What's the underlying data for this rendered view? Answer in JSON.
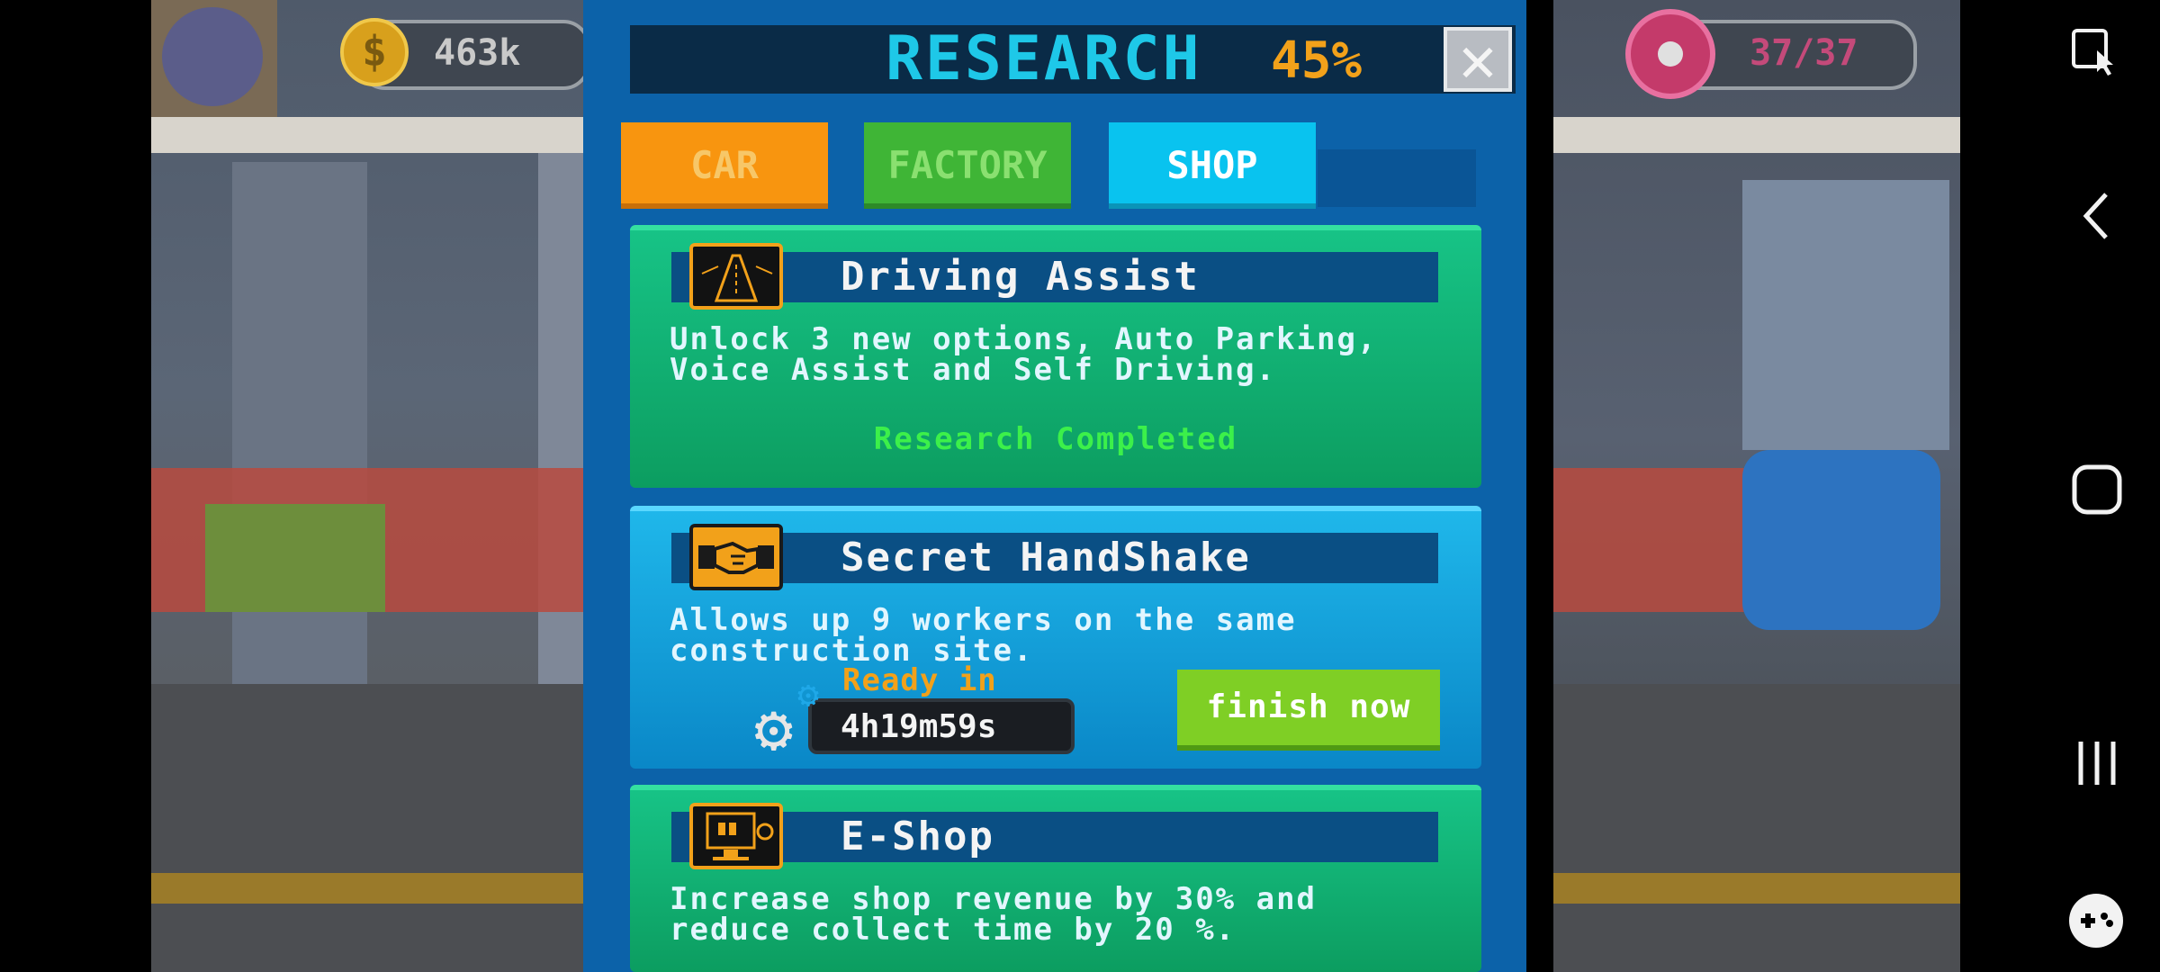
{
  "hud": {
    "money": "463k",
    "donuts": "37/37"
  },
  "research": {
    "title": "RESEARCH",
    "percent": "45%",
    "close_label": "✕"
  },
  "tabs": [
    {
      "label": "CAR"
    },
    {
      "label": "FACTORY"
    },
    {
      "label": "SHOP"
    }
  ],
  "cards": [
    {
      "title": "Driving Assist",
      "description": "Unlock 3 new options, Auto Parking,\nVoice Assist and Self Driving.",
      "status": "Research Completed"
    },
    {
      "title": "Secret HandShake",
      "description": "Allows up 9 workers on the same\nconstruction site.",
      "ready_label": "Ready in",
      "timer": "4h19m59s",
      "finish_label": "finish now"
    },
    {
      "title": "E-Shop",
      "description": "Increase shop revenue by 30% and\nreduce collect time by 20 %."
    }
  ],
  "colors": {
    "modal_bg": "#0c62a9",
    "title_cyan": "#1ec8e8",
    "accent_orange": "#f2a11a",
    "completed_green": "#3cf04a",
    "finish_green": "#7fcf25"
  },
  "icons": {
    "money": "dollar-coin-icon",
    "donut": "donut-icon",
    "driving": "road-icon",
    "handshake": "handshake-icon",
    "eshop": "computer-shop-icon",
    "gear": "gear-icon",
    "nav": [
      "screenshot-touch-icon",
      "back-icon",
      "home-icon",
      "recents-icon",
      "game-controller-icon"
    ]
  }
}
